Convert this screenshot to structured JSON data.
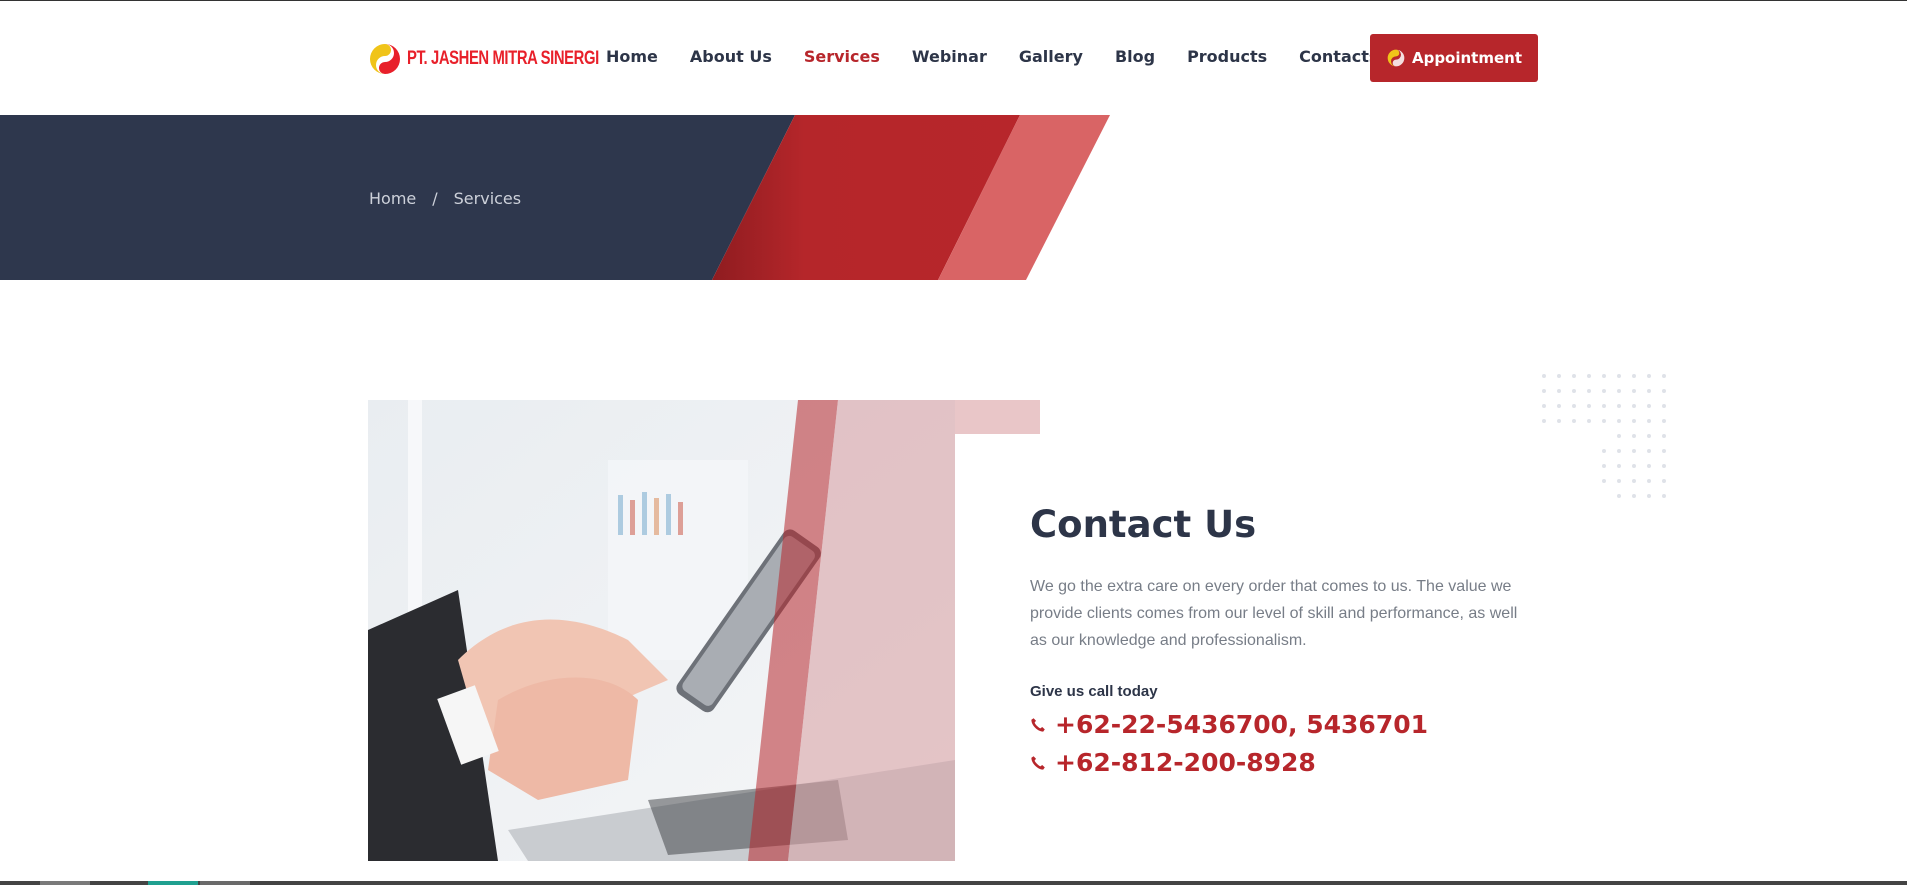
{
  "header": {
    "logo_text": "PT. JASHEN MITRA SINERGI",
    "nav": [
      {
        "label": "Home",
        "active": false
      },
      {
        "label": "About Us",
        "active": false
      },
      {
        "label": "Services",
        "active": true
      },
      {
        "label": "Webinar",
        "active": false
      },
      {
        "label": "Gallery",
        "active": false
      },
      {
        "label": "Blog",
        "active": false
      },
      {
        "label": "Products",
        "active": false
      },
      {
        "label": "Contacts",
        "active": false
      }
    ],
    "appointment_label": "Appointment"
  },
  "breadcrumb": {
    "home": "Home",
    "separator": "/",
    "current": "Services"
  },
  "contact": {
    "title": "Contact Us",
    "description": "We go the extra care on every order that comes to us. The value we provide clients comes from our level of skill and performance, as well as our knowledge and professionalism.",
    "call_label": "Give us call today",
    "phones": [
      "+62-22-5436700, 5436701",
      "+62-812-200-8928"
    ]
  },
  "icons": {
    "phone": "phone-icon",
    "logo": "logo-mark-icon"
  },
  "colors": {
    "accent": "#b7262b",
    "dark": "#2d3548",
    "banner": "#2e374d",
    "text_muted": "#777d87"
  }
}
